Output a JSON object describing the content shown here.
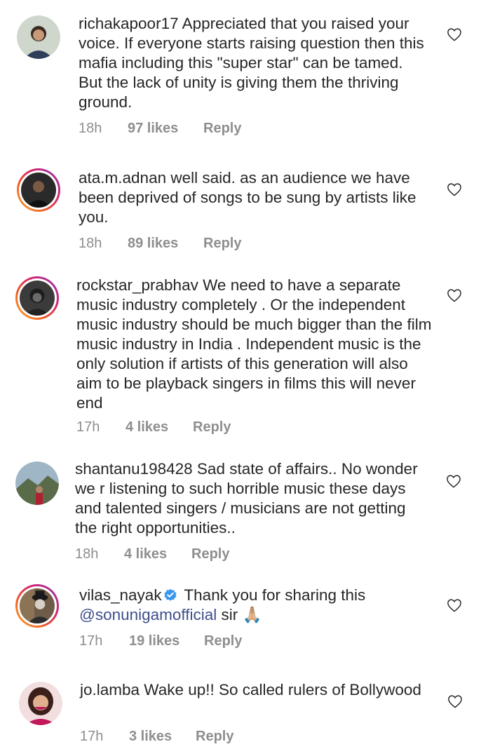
{
  "comments": [
    {
      "username": "richakapoor17",
      "text": " Appreciated that you raised your voice. If everyone starts raising question then this mafia including this \"super star\" can be tamed. But the lack of unity is giving them the thriving ground.",
      "time": "18h",
      "likes": "97 likes",
      "reply": "Reply",
      "avatar_icon": "profile-photo"
    },
    {
      "username": "ata.m.adnan",
      "text": " well said. as an audience we have been deprived of songs to be sung by artists like you.",
      "time": "18h",
      "likes": "89 likes",
      "reply": "Reply",
      "avatar_icon": "profile-photo-story-ring"
    },
    {
      "username": "rockstar_prabhav",
      "text": " We need to have a separate music industry completely . Or the independent music industry should be much bigger than the film music industry in India . Independent music is the only solution if artists of this generation will also aim to be playback singers in films this will never end",
      "time": "17h",
      "likes": "4 likes",
      "reply": "Reply",
      "avatar_icon": "profile-photo-story-ring"
    },
    {
      "username": "shantanu198428",
      "text": " Sad state of affairs.. No wonder we r listening to such horrible music these days and talented singers / musicians are not getting the right opportunities..",
      "time": "18h",
      "likes": "4 likes",
      "reply": "Reply",
      "avatar_icon": "profile-photo"
    },
    {
      "username": "vilas_nayak",
      "text_before_mention": " Thank you for sharing this ",
      "mention": "@sonunigamofficial",
      "text_after_mention": " sir 🙏🏼",
      "verified": true,
      "time": "17h",
      "likes": "19 likes",
      "reply": "Reply",
      "avatar_icon": "profile-photo-story-ring"
    },
    {
      "username": "jo.lamba",
      "text": " Wake up!! So called rulers of Bollywood",
      "time": "17h",
      "likes": "3 likes",
      "reply": "Reply",
      "avatar_icon": "profile-photo"
    }
  ],
  "icons": {
    "like": "heart-outline-icon",
    "verified": "verified-badge-icon"
  },
  "colors": {
    "meta": "#8e8e8e",
    "mention": "#3d4f8a",
    "verified": "#3897f0"
  }
}
